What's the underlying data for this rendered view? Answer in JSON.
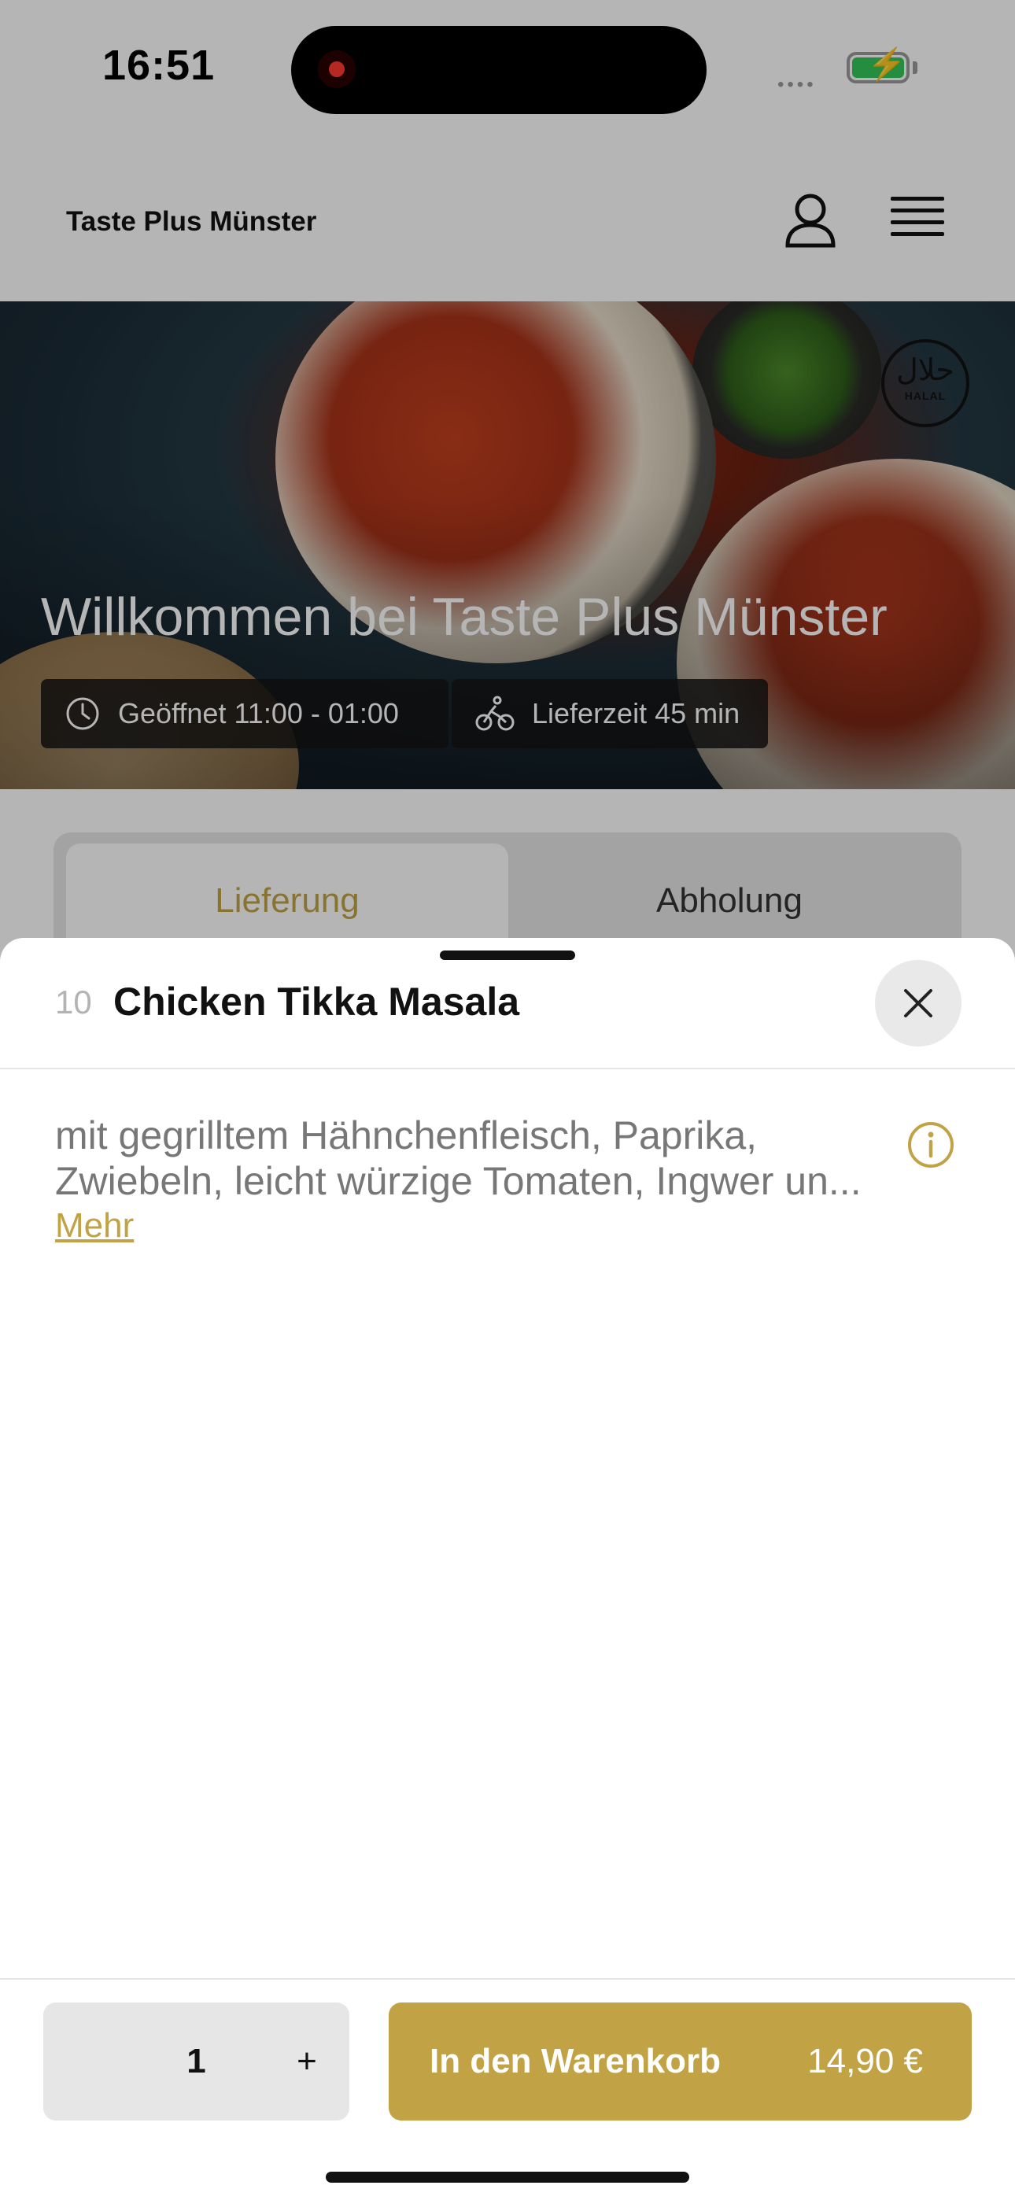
{
  "status_bar": {
    "time": "16:51"
  },
  "header": {
    "site_title": "Taste Plus Münster"
  },
  "hero": {
    "welcome": "Willkommen bei Taste Plus Münster",
    "open_hours": "Geöffnet 11:00 - 01:00",
    "delivery_time": "Lieferzeit 45 min",
    "halal_arabic": "حلال",
    "halal_latin": "HALAL"
  },
  "order_mode": {
    "delivery": "Lieferung",
    "pickup": "Abholung",
    "selected": "delivery"
  },
  "dish": {
    "number": "10",
    "title": "Chicken Tikka Masala",
    "description": "mit gegrilltem Hähnchenfleisch, Paprika, Zwiebeln, leicht würzige Tomaten, Ingwer un...",
    "more_label": "Mehr"
  },
  "cart": {
    "quantity": "1",
    "plus_label": "+",
    "add_label": "In den Warenkorb",
    "price": "14,90 €"
  },
  "colors": {
    "accent": "#c1a346",
    "battery_green": "#34c759",
    "record_red": "#ff3b30"
  },
  "icons": [
    "user-icon",
    "menu-icon",
    "clock-icon",
    "bicycle-icon",
    "close-icon",
    "info-icon"
  ]
}
